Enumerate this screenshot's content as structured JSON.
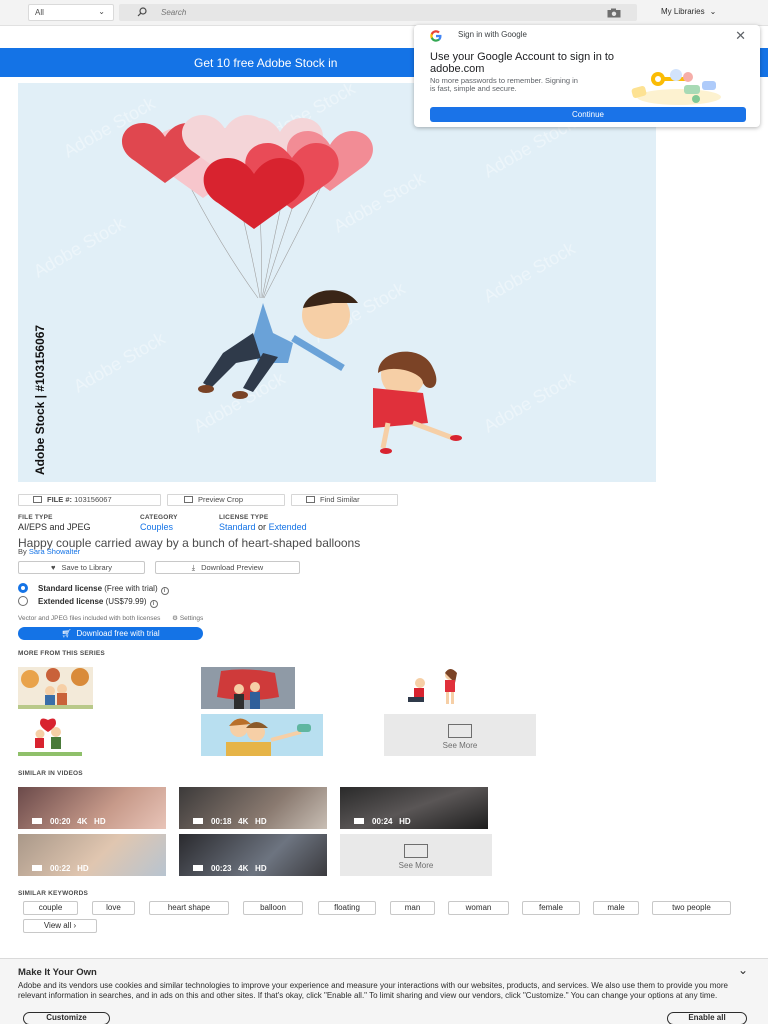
{
  "topbar": {
    "scope_value": "All",
    "search_placeholder": "Search",
    "my_libraries": "My Libraries"
  },
  "promo": {
    "text": "Get 10 free Adobe Stock in"
  },
  "google_popup": {
    "header": "Sign in with Google",
    "title": "Use your Google Account to sign in to adobe.com",
    "body": "No more passwords to remember. Signing in is fast, simple and secure.",
    "continue_label": "Continue"
  },
  "image": {
    "watermark_text": "Adobe Stock",
    "side_id_text": "Adobe Stock | #103156067"
  },
  "actions": {
    "file_label": "FILE #:",
    "file_number": "103156067",
    "preview_crop": "Preview Crop",
    "find_similar": "Find Similar"
  },
  "meta": {
    "file_type_label": "FILE TYPE",
    "file_type_value": "AI/EPS and JPEG",
    "category_label": "CATEGORY",
    "category_value": "Couples",
    "license_type_label": "LICENSE TYPE",
    "license_standard": "Standard",
    "license_or": "or",
    "license_extended": "Extended"
  },
  "asset": {
    "title": "Happy couple carried away by a bunch of heart-shaped balloons",
    "by_prefix": "By",
    "author": "Sara Showalter",
    "save_label": "Save to Library",
    "download_preview_label": "Download Preview"
  },
  "licenses": {
    "standard_name": "Standard license",
    "standard_price": "(Free with trial)",
    "extended_name": "Extended license",
    "extended_price": "(US$79.99)",
    "note": "Vector and JPEG files included with both licenses",
    "settings": "Settings",
    "download_button": "Download free with trial"
  },
  "series": {
    "heading": "MORE FROM THIS SERIES",
    "see_more": "See More"
  },
  "videos": {
    "heading": "SIMILAR IN VIDEOS",
    "items": [
      {
        "duration": "00:20",
        "quality": "4K",
        "hd": "HD"
      },
      {
        "duration": "00:18",
        "quality": "4K",
        "hd": "HD"
      },
      {
        "duration": "00:24",
        "quality": "",
        "hd": "HD"
      },
      {
        "duration": "00:22",
        "quality": "",
        "hd": "HD"
      },
      {
        "duration": "00:23",
        "quality": "4K",
        "hd": "HD"
      }
    ],
    "see_more": "See More"
  },
  "keywords": {
    "heading": "SIMILAR KEYWORDS",
    "items": [
      "couple",
      "love",
      "heart shape",
      "balloon",
      "floating",
      "man",
      "woman",
      "female",
      "male",
      "two people"
    ],
    "view_all": "View all ›"
  },
  "cookie": {
    "title": "Make It Your Own",
    "text": "Adobe and its vendors use cookies and similar technologies to improve your experience and measure your interactions with our websites, products, and services. We also use them to provide you more relevant information in searches, and in ads on this and other sites. If that's okay, click \"Enable all.\" To limit sharing and view our vendors, click \"Customize.\" You can change your options at any time.",
    "customize": "Customize",
    "enable_all": "Enable all"
  },
  "colors": {
    "accent": "#1473e6",
    "google_blue": "#1a73e8",
    "sky": "#e1eff7"
  }
}
